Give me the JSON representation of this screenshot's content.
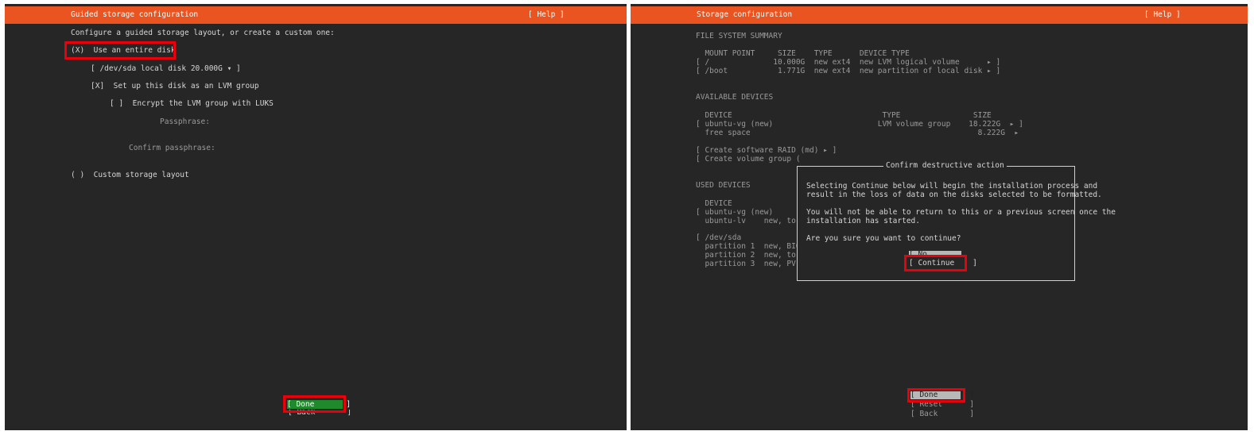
{
  "left": {
    "title": "Guided storage configuration",
    "help": "[ Help ]",
    "intro": "Configure a guided storage layout, or create a custom one:",
    "use_entire_disk": "(X)  Use an entire disk",
    "disk_select": "[ /dev/sda local disk 20.000G ▾ ]",
    "lvm_checkbox": "[X]  Set up this disk as an LVM group",
    "encrypt_checkbox": "[ ]  Encrypt the LVM group with LUKS",
    "passphrase_label": "Passphrase:",
    "confirm_passphrase_label": "Confirm passphrase:",
    "custom_layout": "( )  Custom storage layout",
    "done_button": "[ Done       ]",
    "back_button": "[ Back       ]"
  },
  "right": {
    "title": "Storage configuration",
    "help": "[ Help ]",
    "fs_summary_header": "FILE SYSTEM SUMMARY",
    "fs_columns": "  MOUNT POINT     SIZE    TYPE      DEVICE TYPE",
    "fs_rows": [
      "[ /              10.000G  new ext4  new LVM logical volume      ▸ ]",
      "[ /boot           1.771G  new ext4  new partition of local disk ▸ ]"
    ],
    "available_header": "AVAILABLE DEVICES",
    "available_columns": "  DEVICE                                 TYPE                SIZE",
    "available_rows": [
      "[ ubuntu-vg (new)                       LVM volume group    18.222G  ▸ ]",
      "  free space                                                  8.222G  ▸"
    ],
    "create_raid": "[ Create software RAID (md) ▸ ]",
    "create_volume_group": "[ Create volume group (",
    "used_header": "USED DEVICES",
    "used_lines": [
      "  DEVICE",
      "[ ubuntu-vg (new)",
      "  ubuntu-lv    new, to",
      "",
      "[ /dev/sda",
      "  partition 1  new, BIO",
      "  partition 2  new, to",
      "  partition 3  new, PV"
    ],
    "dialog": {
      "title": "Confirm destructive action",
      "para1": "Selecting Continue below will begin the installation process and\nresult in the loss of data on the disks selected to be formatted.",
      "para2": "You will not be able to return to this or a previous screen once the\ninstallation has started.",
      "question": "Are you sure you want to continue?",
      "no_button": "[ No          ]",
      "continue_button": "[ Continue    ]"
    },
    "done_button": "[ Done       ]",
    "reset_button": "[ Reset      ]",
    "back_button": "[ Back       ]"
  },
  "colors": {
    "header_orange": "#e95420",
    "background": "#262626",
    "highlight_red": "#e8000a",
    "button_green": "#1e8a2c"
  }
}
